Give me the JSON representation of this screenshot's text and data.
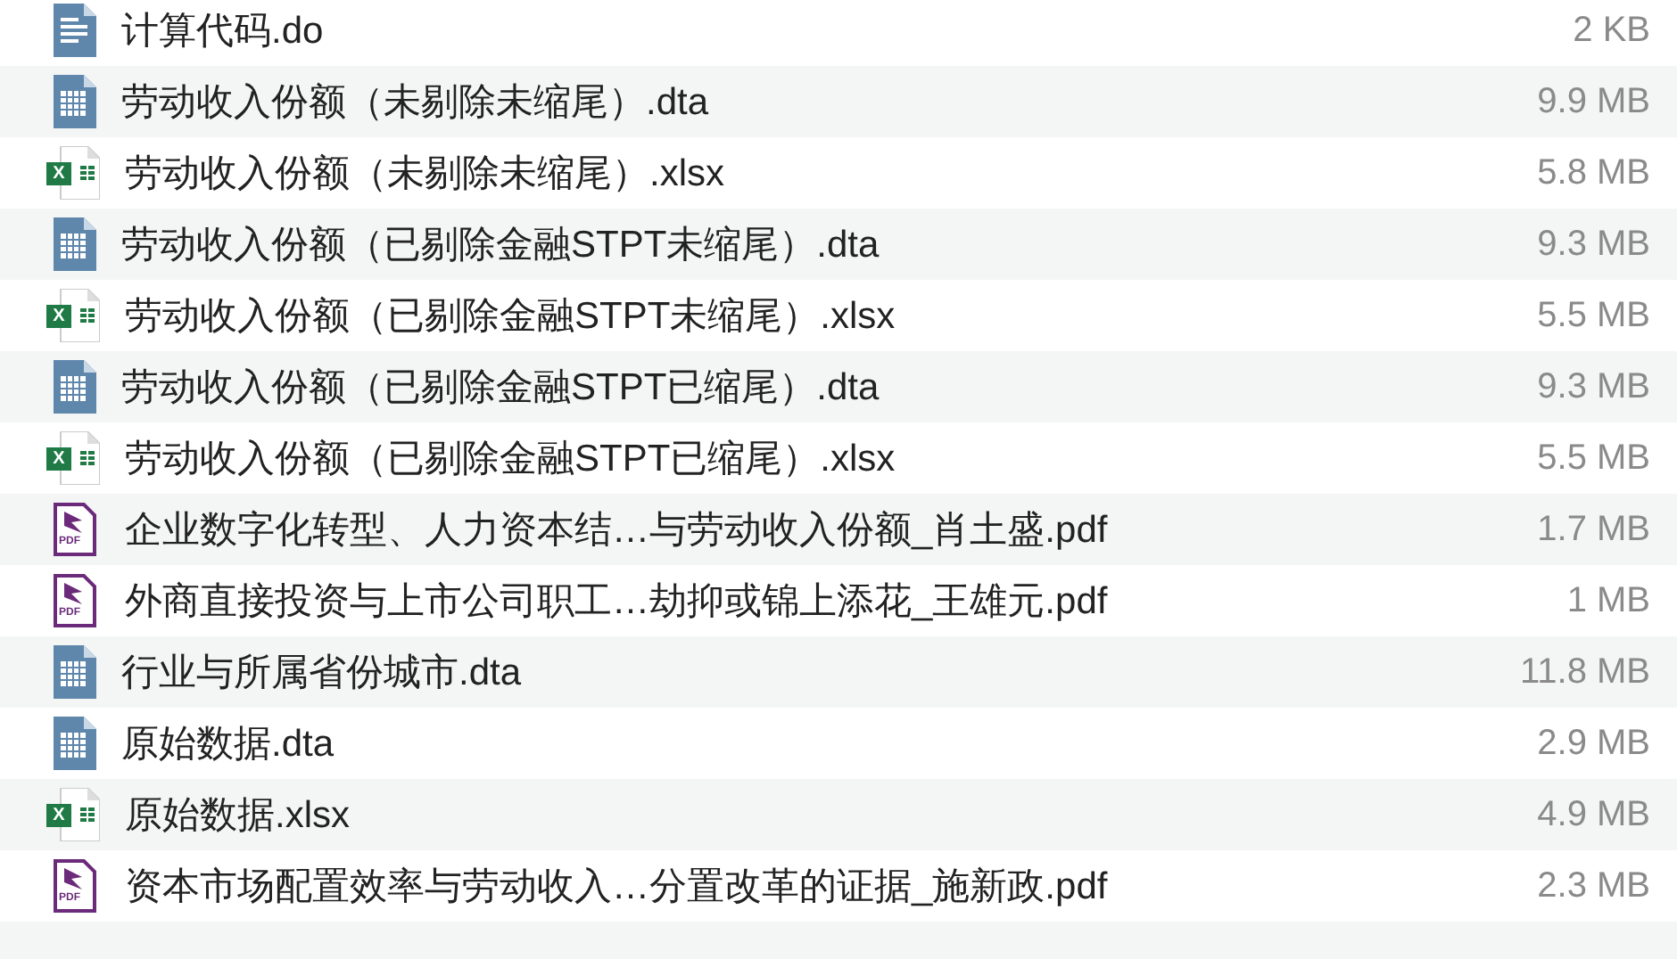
{
  "files": [
    {
      "name": "计算代码.do",
      "size": "2 KB",
      "kind": "text"
    },
    {
      "name": "劳动收入份额（未剔除未缩尾）.dta",
      "size": "9.9 MB",
      "kind": "table"
    },
    {
      "name": "劳动收入份额（未剔除未缩尾）.xlsx",
      "size": "5.8 MB",
      "kind": "excel",
      "icon_text": "X"
    },
    {
      "name": "劳动收入份额（已剔除金融STPT未缩尾）.dta",
      "size": "9.3 MB",
      "kind": "table"
    },
    {
      "name": "劳动收入份额（已剔除金融STPT未缩尾）.xlsx",
      "size": "5.5 MB",
      "kind": "excel",
      "icon_text": "X"
    },
    {
      "name": "劳动收入份额（已剔除金融STPT已缩尾）.dta",
      "size": "9.3 MB",
      "kind": "table"
    },
    {
      "name": "劳动收入份额（已剔除金融STPT已缩尾）.xlsx",
      "size": "5.5 MB",
      "kind": "excel",
      "icon_text": "X"
    },
    {
      "name": "企业数字化转型、人力资本结…与劳动收入份额_肖土盛.pdf",
      "size": "1.7 MB",
      "kind": "pdf",
      "icon_text": "PDF"
    },
    {
      "name": "外商直接投资与上市公司职工…劫抑或锦上添花_王雄元.pdf",
      "size": "1 MB",
      "kind": "pdf",
      "icon_text": "PDF"
    },
    {
      "name": "行业与所属省份城市.dta",
      "size": "11.8 MB",
      "kind": "table"
    },
    {
      "name": "原始数据.dta",
      "size": "2.9 MB",
      "kind": "table"
    },
    {
      "name": "原始数据.xlsx",
      "size": "4.9 MB",
      "kind": "excel",
      "icon_text": "X"
    },
    {
      "name": "资本市场配置效率与劳动收入…分置改革的证据_施新政.pdf",
      "size": "2.3 MB",
      "kind": "pdf",
      "icon_text": "PDF"
    }
  ]
}
